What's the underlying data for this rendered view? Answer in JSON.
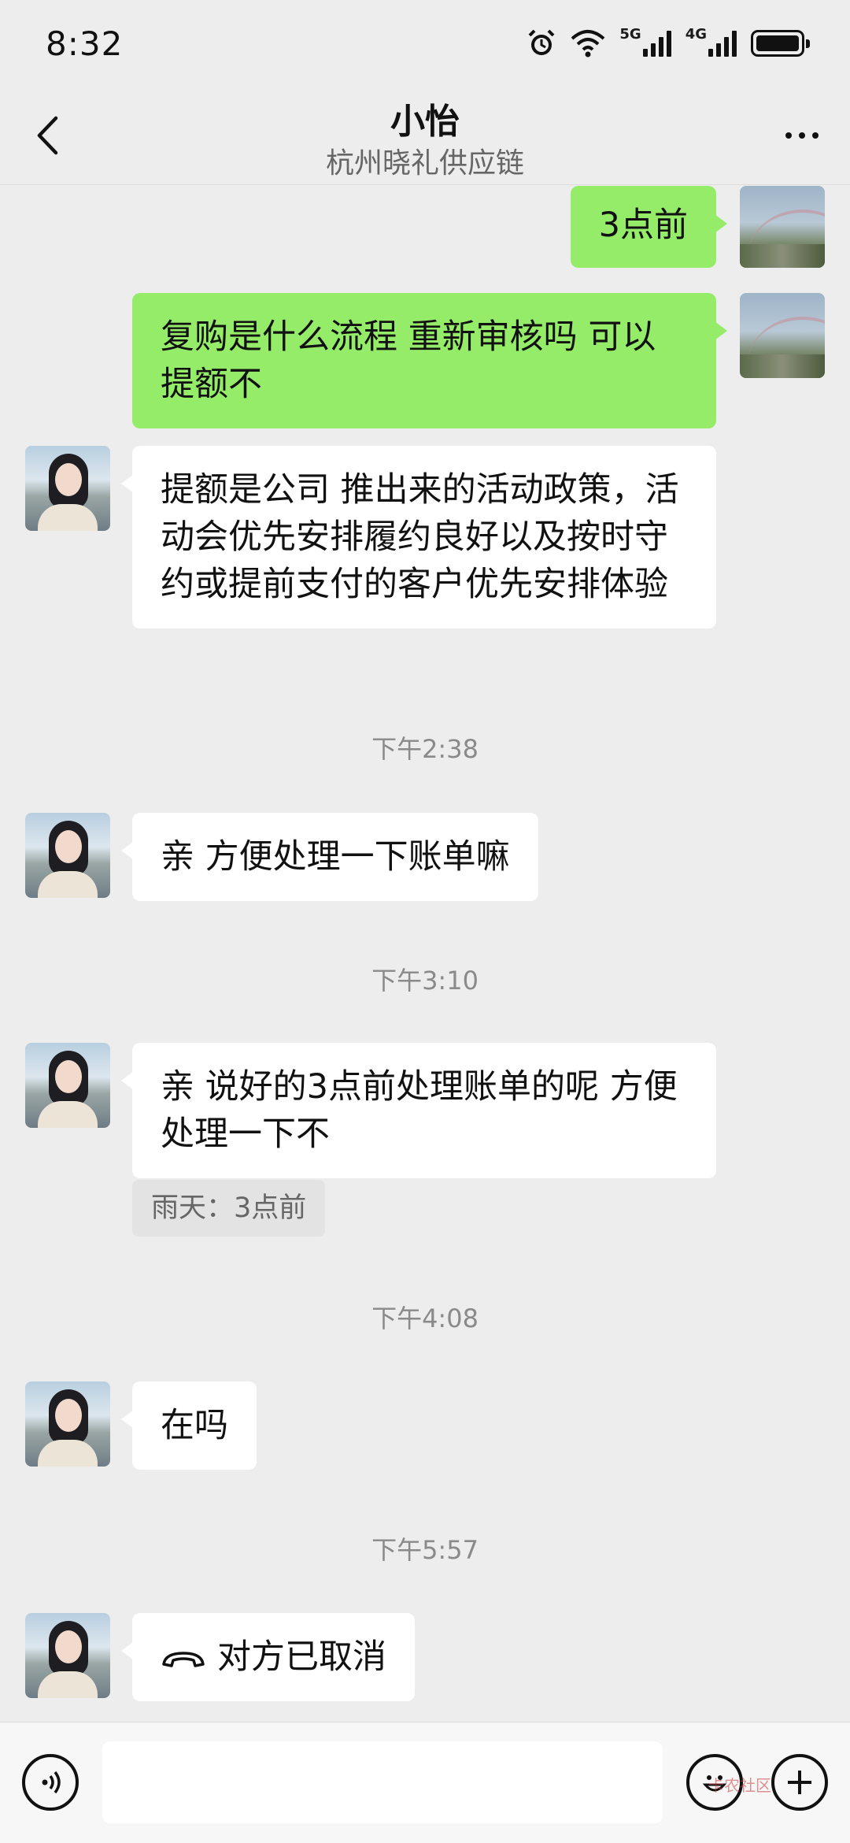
{
  "status": {
    "time": "8:32",
    "network1": "5G",
    "network2": "4G"
  },
  "header": {
    "title": "小怡",
    "subtitle": "杭州晓礼供应链"
  },
  "messages": {
    "m1": "3点前",
    "m2": "复购是什么流程  重新审核吗  可以提额不",
    "m3": "提额是公司 推出来的活动政策，活动会优先安排履约良好以及按时守约或提前支付的客户优先安排体验",
    "t1": "下午2:38",
    "m4": "亲  方便处理一下账单嘛",
    "t2": "下午3:10",
    "m5": "亲  说好的3点前处理账单的呢  方便处理一下不",
    "q5": "雨天：3点前",
    "t3": "下午4:08",
    "m6": "在吗",
    "t4": "下午5:57",
    "m7": "对方已取消"
  },
  "watermark": "卡农社区"
}
